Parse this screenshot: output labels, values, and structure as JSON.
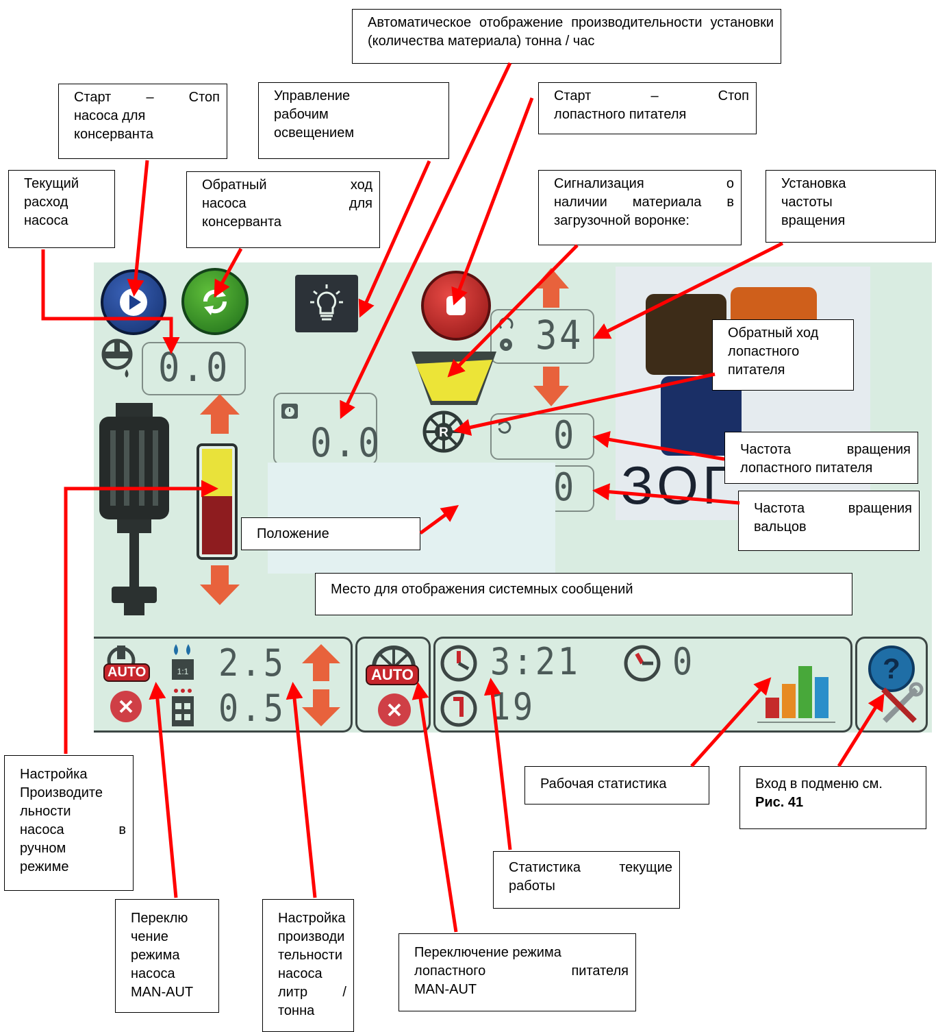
{
  "screen": {
    "pump_flow_value": "0.0",
    "capacity_value": "0.0",
    "rotation_freq_setting": "34",
    "feeder_rotation_value": "0",
    "roller_rotation_value": "0",
    "pump_rate_value": "2.5",
    "pump_rate_setting": "0.5",
    "pump_mode_badge": "AUTO",
    "feeder_mode_badge": "AUTO",
    "work_time": "3:21",
    "stat_counter_1": "0",
    "stat_counter_2": "19",
    "brand_partial": "ЗОГ",
    "level_bar": {
      "yellow_fraction": 0.45,
      "red_fraction": 0.55
    },
    "colors": {
      "accent_red": "#e8202a",
      "lcd_background": "#d9ece1",
      "lcd_digits": "#4c5a58",
      "arrow_orange": "#e8623c"
    },
    "icons": [
      "play-icon",
      "refresh-icon",
      "light-bulb-icon",
      "stop-icon",
      "arrow-up-icon",
      "arrow-down-icon",
      "hopper-icon",
      "reverse-wheel-icon",
      "rollers-icon",
      "help-icon",
      "wrench-icon",
      "stats-bars-icon"
    ]
  },
  "callouts": {
    "auto_capacity": "Автоматическое отображение производительности установки (количества материала) тонна / час",
    "pump_start_stop": [
      "Старт – Стоп",
      "насоса для",
      "консерванта"
    ],
    "lighting": [
      "Управление",
      "рабочим",
      "освещением"
    ],
    "feeder_start_stop": [
      "Старт – Стоп",
      "лопастного питателя"
    ],
    "current_flow": [
      "Текущий",
      "расход",
      "насоса"
    ],
    "pump_reverse": [
      "Обратный ход",
      "насоса для",
      "консерванта"
    ],
    "material_signal": [
      "Сигнализация о",
      "наличии материала в",
      "загрузочной воронке:"
    ],
    "rotation_setting": [
      "Установка",
      "частоты",
      "вращения"
    ],
    "feeder_reverse": [
      "Обратный ход",
      "лопастного",
      "питателя"
    ],
    "feeder_frequency": [
      "Частота вращения",
      "лопастного питателя"
    ],
    "roller_frequency": [
      "Частота вращения",
      "вальцов"
    ],
    "position": "Положение",
    "system_messages": "Место для отображения системных сообщений",
    "pump_manual_capacity": [
      "Настройка",
      "Производите",
      "льности",
      "насоса в",
      "ручном",
      "режиме"
    ],
    "work_statistics": "Рабочая статистика",
    "submenu": "Вход в подменю см.",
    "submenu_bold": "Рис. 41",
    "pump_mode_switch": [
      "Переклю",
      "чение",
      "режима",
      "насоса",
      "MAN-AUT"
    ],
    "pump_rate_setting": [
      "Настройка",
      "производи",
      "тельности",
      "насоса",
      "литр /",
      "тонна"
    ],
    "current_work_stats": [
      "Статистика текущие",
      "работы"
    ],
    "feeder_mode_switch": [
      "Переключение режима",
      "лопастного питателя",
      "MAN-AUT"
    ]
  }
}
